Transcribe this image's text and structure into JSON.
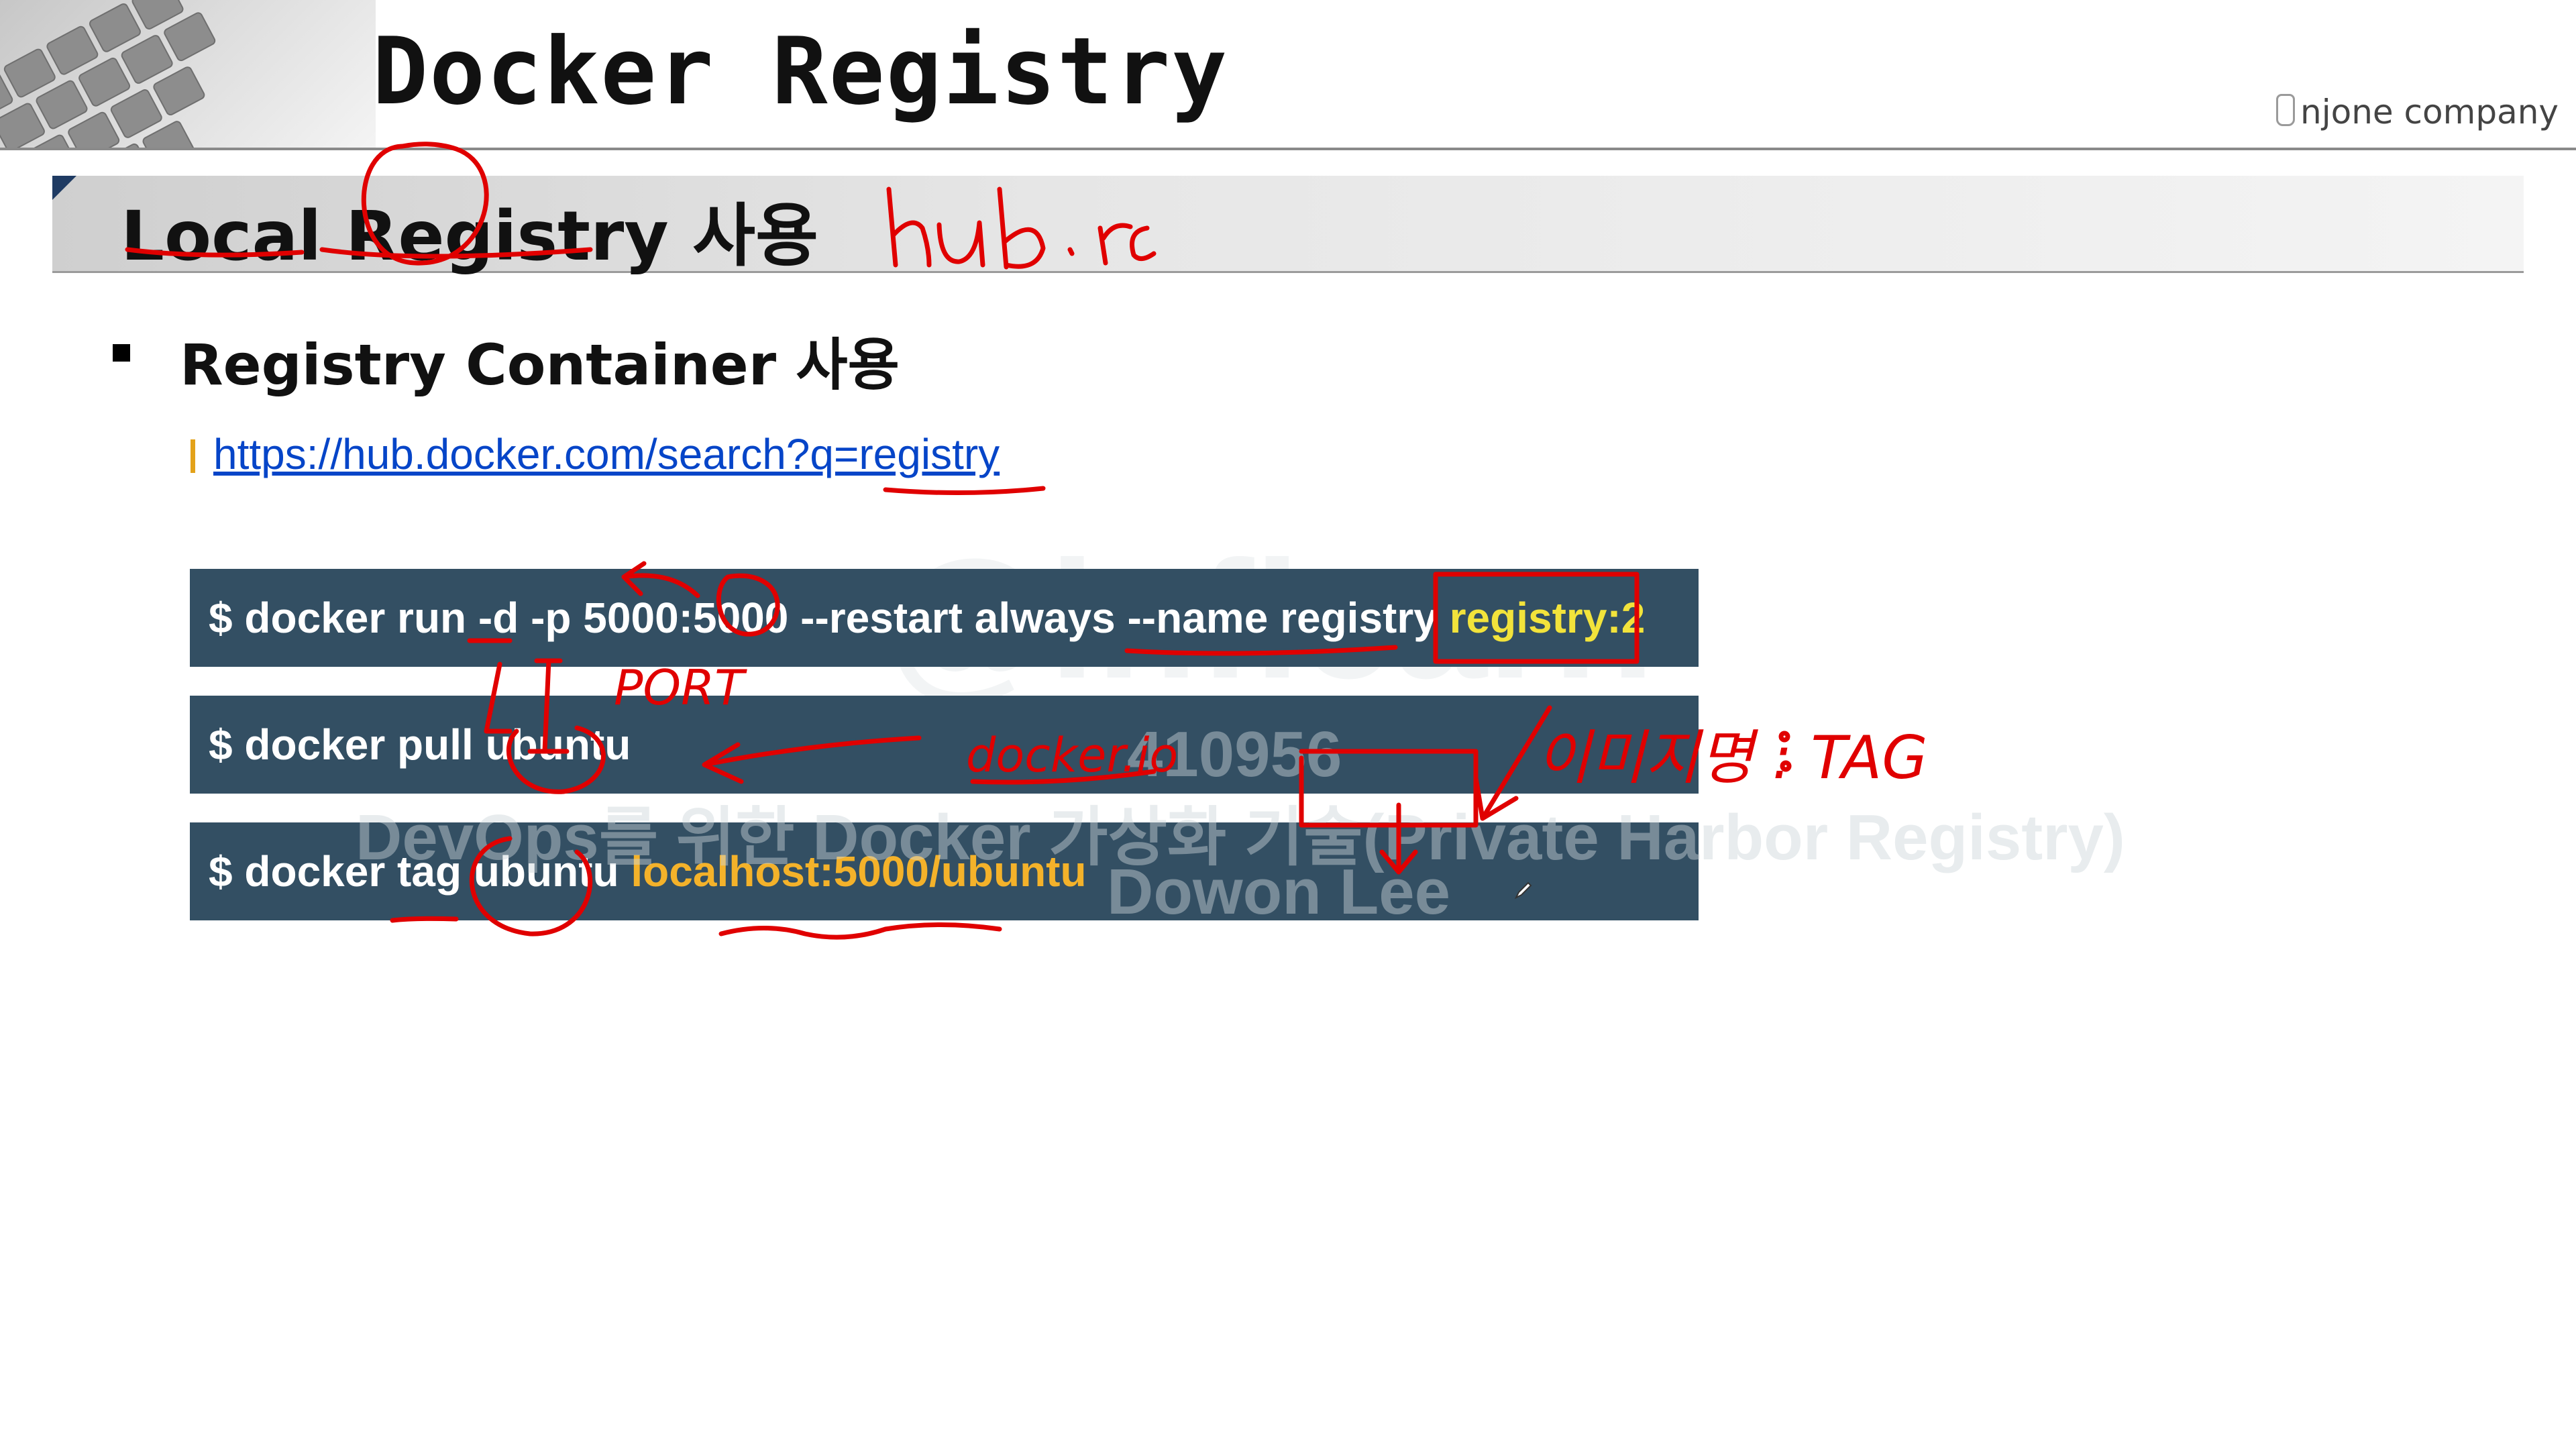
{
  "header": {
    "title": "Docker Registry",
    "brand": "njone company"
  },
  "section": {
    "title": "Local Registry 사용"
  },
  "bullet": {
    "text": "Registry Container 사용"
  },
  "link": {
    "url": "https://hub.docker.com/search?q=registry"
  },
  "commands": [
    {
      "prefix": "$ docker run -d -p 5000:5000 --restart always --name registry ",
      "highlight": "registry:2",
      "highlight_color": "#f2e33b"
    },
    {
      "prefix": "$ docker pull ubuntu",
      "highlight": "",
      "highlight_color": ""
    },
    {
      "prefix": "$ docker tag ubuntu ",
      "highlight": "localhost:5000/ubuntu",
      "highlight_color": "#f4b22a"
    }
  ],
  "watermark": {
    "logo": "@inflearn",
    "id": "410956",
    "course": "DevOps를 위한 Docker 가상화 기술(Private Harbor Registry)",
    "author": "Dowon Lee"
  },
  "annotations": {
    "hub": "hub.rc",
    "port": "PORT",
    "docker_io": "docker.io",
    "image_tag": "이미지명 : TAG"
  },
  "colors": {
    "command_bg": "#334f63",
    "link": "#0645c8",
    "annotation": "#e00000",
    "marker": "#e3a21a"
  }
}
